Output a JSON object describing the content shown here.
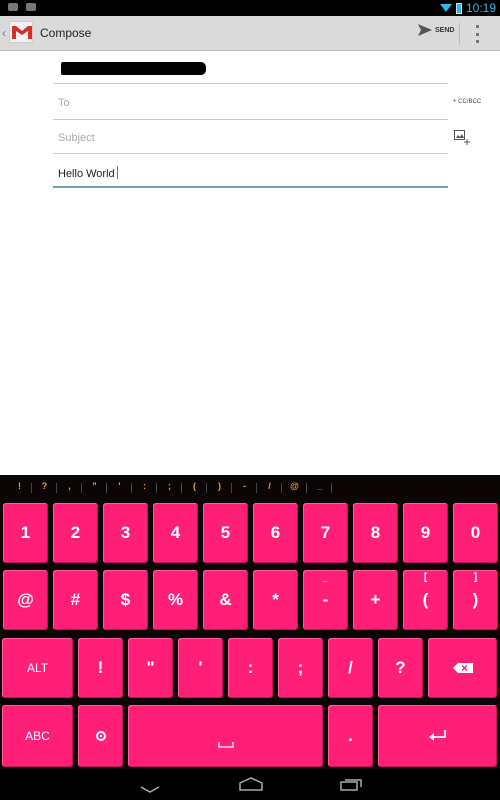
{
  "statusbar": {
    "time": "10:19"
  },
  "actionbar": {
    "title": "Compose",
    "send_label": "SEND"
  },
  "compose": {
    "to_placeholder": "To",
    "subject_placeholder": "Subject",
    "body_text": "Hello World",
    "ccbcc_label": "+ CC/BCC"
  },
  "keyboard": {
    "color": "#ff1f77",
    "suggestions": [
      "!",
      "?",
      ",",
      "\"",
      "'",
      ":",
      ";",
      "(",
      ")",
      "-",
      "/",
      "@",
      "_"
    ],
    "row1": [
      "1",
      "2",
      "3",
      "4",
      "5",
      "6",
      "7",
      "8",
      "9",
      "0"
    ],
    "row2": [
      {
        "label": "@",
        "alt": ""
      },
      {
        "label": "#",
        "alt": ""
      },
      {
        "label": "$",
        "alt": ""
      },
      {
        "label": "%",
        "alt": ""
      },
      {
        "label": "&",
        "alt": ""
      },
      {
        "label": "*",
        "alt": ""
      },
      {
        "label": "-",
        "alt": "_"
      },
      {
        "label": "+",
        "alt": ""
      },
      {
        "label": "(",
        "alt": "["
      },
      {
        "label": ")",
        "alt": "]"
      }
    ],
    "row3": {
      "alt_label": "ALT",
      "keys": [
        "!",
        "\"",
        "'",
        ":",
        ";",
        "/",
        "?"
      ]
    },
    "row4": {
      "abc_label": "ABC",
      "space_label": "⎵",
      "period_label": "."
    }
  }
}
